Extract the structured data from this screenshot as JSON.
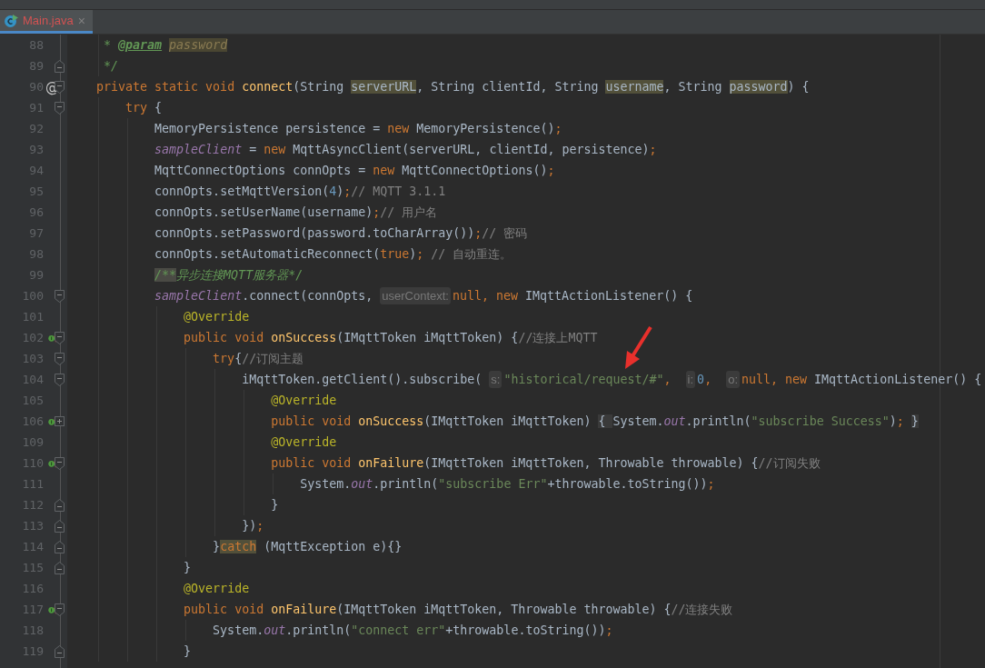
{
  "tab": {
    "label": "Main.java",
    "close": "×",
    "selected": true,
    "error": true
  },
  "lines": [
    {
      "number": "88",
      "fold_start": false,
      "fold_end": false,
      "collapsed": false,
      "implements": false,
      "tokens": [
        {
          "kind": "doc",
          "text": "     * "
        },
        {
          "kind": "doctag",
          "text": "@param"
        },
        {
          "kind": "docparam",
          "text": " password"
        }
      ]
    },
    {
      "number": "89",
      "fold_start": false,
      "fold_end": true,
      "collapsed": false,
      "implements": false,
      "tokens": [
        {
          "kind": "doc",
          "text": "     */"
        }
      ]
    },
    {
      "number": "90",
      "marker": "@",
      "fold_start": true,
      "fold_end": false,
      "collapsed": false,
      "implements": false,
      "tokens": [
        {
          "kind": "keyword",
          "text": "    private static void "
        },
        {
          "kind": "method",
          "text": "connect"
        },
        {
          "kind": "plain",
          "text": "(String "
        },
        {
          "kind": "usage",
          "text": "serverURL"
        },
        {
          "kind": "plain",
          "text": ", String clientId, String "
        },
        {
          "kind": "usage",
          "text": "username"
        },
        {
          "kind": "plain",
          "text": ", String "
        },
        {
          "kind": "usage",
          "text": "password"
        },
        {
          "kind": "plain",
          "text": ") {"
        }
      ]
    },
    {
      "number": "91",
      "fold_start": true,
      "fold_end": false,
      "collapsed": false,
      "implements": false,
      "tokens": [
        {
          "kind": "keyword",
          "text": "        try"
        },
        {
          "kind": "plain",
          "text": " {"
        }
      ]
    },
    {
      "number": "92",
      "fold_start": false,
      "fold_end": false,
      "collapsed": false,
      "implements": false,
      "tokens": [
        {
          "kind": "plain",
          "text": "            MemoryPersistence persistence = "
        },
        {
          "kind": "keyword",
          "text": "new"
        },
        {
          "kind": "plain",
          "text": " MemoryPersistence()"
        },
        {
          "kind": "keyword",
          "text": ";"
        }
      ]
    },
    {
      "number": "93",
      "fold_start": false,
      "fold_end": false,
      "collapsed": false,
      "implements": false,
      "tokens": [
        {
          "kind": "field",
          "text": "            sampleClient"
        },
        {
          "kind": "plain",
          "text": " = "
        },
        {
          "kind": "keyword",
          "text": "new"
        },
        {
          "kind": "plain",
          "text": " MqttAsyncClient(serverURL, clientId, persistence)"
        },
        {
          "kind": "keyword",
          "text": ";"
        }
      ]
    },
    {
      "number": "94",
      "fold_start": false,
      "fold_end": false,
      "collapsed": false,
      "implements": false,
      "tokens": [
        {
          "kind": "plain",
          "text": "            MqttConnectOptions connOpts = "
        },
        {
          "kind": "keyword",
          "text": "new"
        },
        {
          "kind": "plain",
          "text": " MqttConnectOptions()"
        },
        {
          "kind": "keyword",
          "text": ";"
        }
      ]
    },
    {
      "number": "95",
      "fold_start": false,
      "fold_end": false,
      "collapsed": false,
      "implements": false,
      "tokens": [
        {
          "kind": "plain",
          "text": "            connOpts.setMqttVersion("
        },
        {
          "kind": "number",
          "text": "4"
        },
        {
          "kind": "plain",
          "text": ")"
        },
        {
          "kind": "keyword",
          "text": ";"
        },
        {
          "kind": "comment",
          "text": "// MQTT 3.1.1"
        }
      ]
    },
    {
      "number": "96",
      "fold_start": false,
      "fold_end": false,
      "collapsed": false,
      "implements": false,
      "tokens": [
        {
          "kind": "plain",
          "text": "            connOpts.setUserName(username)"
        },
        {
          "kind": "keyword",
          "text": ";"
        },
        {
          "kind": "comment",
          "text": "// 用户名"
        }
      ]
    },
    {
      "number": "97",
      "fold_start": false,
      "fold_end": false,
      "collapsed": false,
      "implements": false,
      "tokens": [
        {
          "kind": "plain",
          "text": "            connOpts.setPassword(password.toCharArray())"
        },
        {
          "kind": "keyword",
          "text": ";"
        },
        {
          "kind": "comment",
          "text": "// 密码"
        }
      ]
    },
    {
      "number": "98",
      "fold_start": false,
      "fold_end": false,
      "collapsed": false,
      "implements": false,
      "tokens": [
        {
          "kind": "plain",
          "text": "            connOpts.setAutomaticReconnect("
        },
        {
          "kind": "keyword",
          "text": "true"
        },
        {
          "kind": "plain",
          "text": ")"
        },
        {
          "kind": "keyword",
          "text": ";"
        },
        {
          "kind": "comment",
          "text": " // 自动重连。"
        }
      ]
    },
    {
      "number": "99",
      "fold_start": false,
      "fold_end": false,
      "collapsed": false,
      "implements": false,
      "tokens": [
        {
          "kind": "doc-marked",
          "text": "            /**"
        },
        {
          "kind": "doc",
          "text": "异步连接MQTT服务器*/"
        }
      ]
    },
    {
      "number": "100",
      "fold_start": true,
      "fold_end": false,
      "collapsed": false,
      "implements": false,
      "tokens": [
        {
          "kind": "field",
          "text": "            sampleClient"
        },
        {
          "kind": "plain",
          "text": ".connect(connOpts, "
        },
        {
          "kind": "hint",
          "text": "userContext:"
        },
        {
          "kind": "keyword",
          "text": "null, new"
        },
        {
          "kind": "plain",
          "text": " IMqttActionListener() {"
        }
      ]
    },
    {
      "number": "101",
      "fold_start": false,
      "fold_end": false,
      "collapsed": false,
      "implements": false,
      "tokens": [
        {
          "kind": "annotation",
          "text": "                @Override"
        }
      ]
    },
    {
      "number": "102",
      "fold_start": true,
      "fold_end": false,
      "collapsed": false,
      "implements": true,
      "tokens": [
        {
          "kind": "keyword",
          "text": "                public void "
        },
        {
          "kind": "method",
          "text": "onSuccess"
        },
        {
          "kind": "plain",
          "text": "(IMqttToken iMqttToken) {"
        },
        {
          "kind": "comment",
          "text": "//连接上MQTT"
        }
      ]
    },
    {
      "number": "103",
      "fold_start": true,
      "fold_end": false,
      "collapsed": false,
      "implements": false,
      "tokens": [
        {
          "kind": "keyword",
          "text": "                    try"
        },
        {
          "kind": "plain",
          "text": "{"
        },
        {
          "kind": "comment",
          "text": "//订阅主题"
        }
      ]
    },
    {
      "number": "104",
      "fold_start": true,
      "fold_end": false,
      "collapsed": false,
      "implements": false,
      "tokens": [
        {
          "kind": "plain",
          "text": "                        iMqttToken.getClient().subscribe( "
        },
        {
          "kind": "hint",
          "text": "s:"
        },
        {
          "kind": "string",
          "text": "\"historical/request/#\""
        },
        {
          "kind": "keyword",
          "text": ",  "
        },
        {
          "kind": "hint",
          "text": "i:"
        },
        {
          "kind": "number",
          "text": "0"
        },
        {
          "kind": "keyword",
          "text": ",  "
        },
        {
          "kind": "hint",
          "text": "o:"
        },
        {
          "kind": "keyword",
          "text": "null, new"
        },
        {
          "kind": "plain",
          "text": " IMqttActionListener() {"
        }
      ]
    },
    {
      "number": "105",
      "fold_start": false,
      "fold_end": false,
      "collapsed": false,
      "implements": false,
      "tokens": [
        {
          "kind": "annotation",
          "text": "                            @Override"
        }
      ]
    },
    {
      "number": "106",
      "fold_start": false,
      "fold_end": false,
      "collapsed": true,
      "implements": true,
      "tokens": [
        {
          "kind": "keyword",
          "text": "                            public void "
        },
        {
          "kind": "method",
          "text": "onSuccess"
        },
        {
          "kind": "plain",
          "text": "(IMqttToken iMqttToken) "
        },
        {
          "kind": "folded",
          "text": "{ "
        },
        {
          "kind": "plain",
          "text": "System."
        },
        {
          "kind": "field",
          "text": "out"
        },
        {
          "kind": "plain",
          "text": ".println("
        },
        {
          "kind": "string",
          "text": "\"subscribe Success\""
        },
        {
          "kind": "plain",
          "text": ")"
        },
        {
          "kind": "keyword",
          "text": ";"
        },
        {
          "kind": "folded",
          "text": " }"
        }
      ]
    },
    {
      "number": "109",
      "fold_start": false,
      "fold_end": false,
      "collapsed": false,
      "implements": false,
      "tokens": [
        {
          "kind": "annotation",
          "text": "                            @Override"
        }
      ]
    },
    {
      "number": "110",
      "fold_start": true,
      "fold_end": false,
      "collapsed": false,
      "implements": true,
      "tokens": [
        {
          "kind": "keyword",
          "text": "                            public void "
        },
        {
          "kind": "method",
          "text": "onFailure"
        },
        {
          "kind": "plain",
          "text": "(IMqttToken iMqttToken, Throwable throwable) {"
        },
        {
          "kind": "comment",
          "text": "//订阅失败"
        }
      ]
    },
    {
      "number": "111",
      "fold_start": false,
      "fold_end": false,
      "collapsed": false,
      "implements": false,
      "tokens": [
        {
          "kind": "plain",
          "text": "                                System."
        },
        {
          "kind": "field",
          "text": "out"
        },
        {
          "kind": "plain",
          "text": ".println("
        },
        {
          "kind": "string",
          "text": "\"subscribe Err\""
        },
        {
          "kind": "plain",
          "text": "+throwable.toString())"
        },
        {
          "kind": "keyword",
          "text": ";"
        }
      ]
    },
    {
      "number": "112",
      "fold_start": false,
      "fold_end": true,
      "collapsed": false,
      "implements": false,
      "tokens": [
        {
          "kind": "plain",
          "text": "                            }"
        }
      ]
    },
    {
      "number": "113",
      "fold_start": false,
      "fold_end": true,
      "collapsed": false,
      "implements": false,
      "tokens": [
        {
          "kind": "plain",
          "text": "                        })"
        },
        {
          "kind": "keyword",
          "text": ";"
        }
      ]
    },
    {
      "number": "114",
      "fold_start": false,
      "fold_end": true,
      "collapsed": false,
      "implements": false,
      "tokens": [
        {
          "kind": "plain",
          "text": "                    }"
        },
        {
          "kind": "keyword-marked",
          "text": "catch"
        },
        {
          "kind": "plain",
          "text": " (MqttException e){}"
        }
      ]
    },
    {
      "number": "115",
      "fold_start": false,
      "fold_end": true,
      "collapsed": false,
      "implements": false,
      "tokens": [
        {
          "kind": "plain",
          "text": "                }"
        }
      ]
    },
    {
      "number": "116",
      "fold_start": false,
      "fold_end": false,
      "collapsed": false,
      "implements": false,
      "tokens": [
        {
          "kind": "annotation",
          "text": "                @Override"
        }
      ]
    },
    {
      "number": "117",
      "fold_start": true,
      "fold_end": false,
      "collapsed": false,
      "implements": true,
      "tokens": [
        {
          "kind": "keyword",
          "text": "                public void "
        },
        {
          "kind": "method",
          "text": "onFailure"
        },
        {
          "kind": "plain",
          "text": "(IMqttToken iMqttToken, Throwable throwable) {"
        },
        {
          "kind": "comment",
          "text": "//连接失败"
        }
      ]
    },
    {
      "number": "118",
      "fold_start": false,
      "fold_end": false,
      "collapsed": false,
      "implements": false,
      "tokens": [
        {
          "kind": "plain",
          "text": "                    System."
        },
        {
          "kind": "field",
          "text": "out"
        },
        {
          "kind": "plain",
          "text": ".println("
        },
        {
          "kind": "string",
          "text": "\"connect err\""
        },
        {
          "kind": "plain",
          "text": "+throwable.toString())"
        },
        {
          "kind": "keyword",
          "text": ";"
        }
      ]
    },
    {
      "number": "119",
      "fold_start": false,
      "fold_end": true,
      "collapsed": false,
      "implements": false,
      "tokens": [
        {
          "kind": "plain",
          "text": "                }"
        }
      ]
    }
  ]
}
